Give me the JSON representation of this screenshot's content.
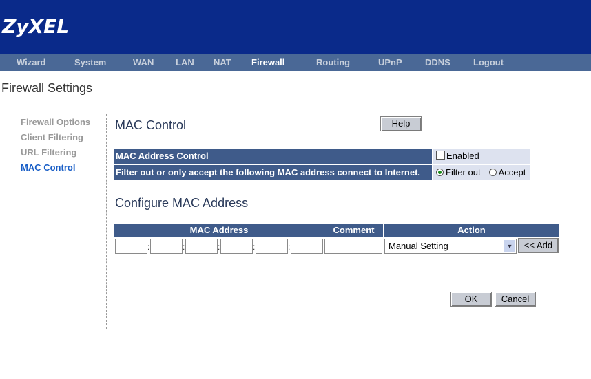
{
  "brand": {
    "logo": "ZyXEL"
  },
  "nav": {
    "items": [
      {
        "label": "Wizard"
      },
      {
        "label": "System"
      },
      {
        "label": "WAN"
      },
      {
        "label": "LAN"
      },
      {
        "label": "NAT"
      },
      {
        "label": "Firewall",
        "active": true
      },
      {
        "label": "Routing"
      },
      {
        "label": "UPnP"
      },
      {
        "label": "DDNS"
      },
      {
        "label": "Logout"
      }
    ]
  },
  "page": {
    "title": "Firewall Settings"
  },
  "sidebar": {
    "items": [
      {
        "label": "Firewall Options"
      },
      {
        "label": "Client Filtering"
      },
      {
        "label": "URL Filtering"
      },
      {
        "label": "MAC Control",
        "active": true
      }
    ]
  },
  "mac_control": {
    "title": "MAC Control",
    "help_label": "Help",
    "address_control_label": "MAC Address Control",
    "enabled_label": "Enabled",
    "enabled_checked": false,
    "filter_label": "Filter out or only accept  the following MAC address  connect to Internet.",
    "filter_out_label": "Filter out",
    "accept_label": "Accept",
    "selected_mode": "Filter out"
  },
  "configure": {
    "title": "Configure MAC Address",
    "headers": {
      "mac": "MAC Address",
      "comment": "Comment",
      "action": "Action"
    },
    "mac_separator": ":",
    "action_selected": "Manual Setting",
    "add_label": "<< Add"
  },
  "footer": {
    "ok_label": "OK",
    "cancel_label": "Cancel"
  },
  "colors": {
    "header_bg": "#0a2a8a",
    "nav_bg": "#4a6896",
    "table_header_bg": "#3f5b8a",
    "value_cell_bg": "#dde2ef",
    "sidebar_active": "#1a5fc7"
  }
}
